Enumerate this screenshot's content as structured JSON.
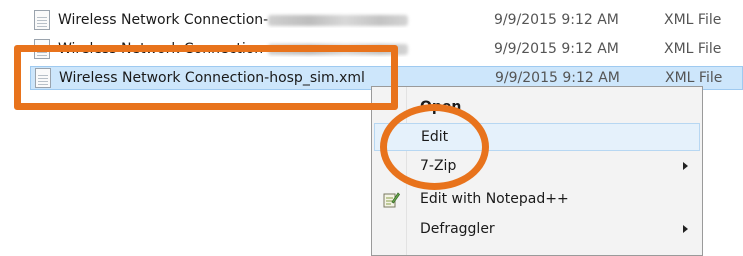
{
  "files": [
    {
      "name_prefix": "Wireless Network Connection-",
      "name_redacted": true,
      "date": "9/9/2015 9:12 AM",
      "type": "XML File"
    },
    {
      "name_prefix": "Wireless Network Connection-",
      "name_redacted": true,
      "date": "9/9/2015 9:12 AM",
      "type": "XML File"
    },
    {
      "name": "Wireless Network Connection-hosp_sim.xml",
      "date": "9/9/2015 9:12 AM",
      "type": "XML File",
      "selected": true
    }
  ],
  "context_menu": {
    "items": [
      {
        "label": "Open",
        "bold": true
      },
      {
        "label": "Edit",
        "highlighted": true
      },
      {
        "label": "7-Zip",
        "submenu": true
      },
      {
        "label": "Edit with Notepad++",
        "icon": "notepad-plus-plus-icon"
      },
      {
        "label": "Defraggler",
        "submenu": true
      }
    ]
  },
  "annotations": {
    "color": "#e8731c"
  }
}
